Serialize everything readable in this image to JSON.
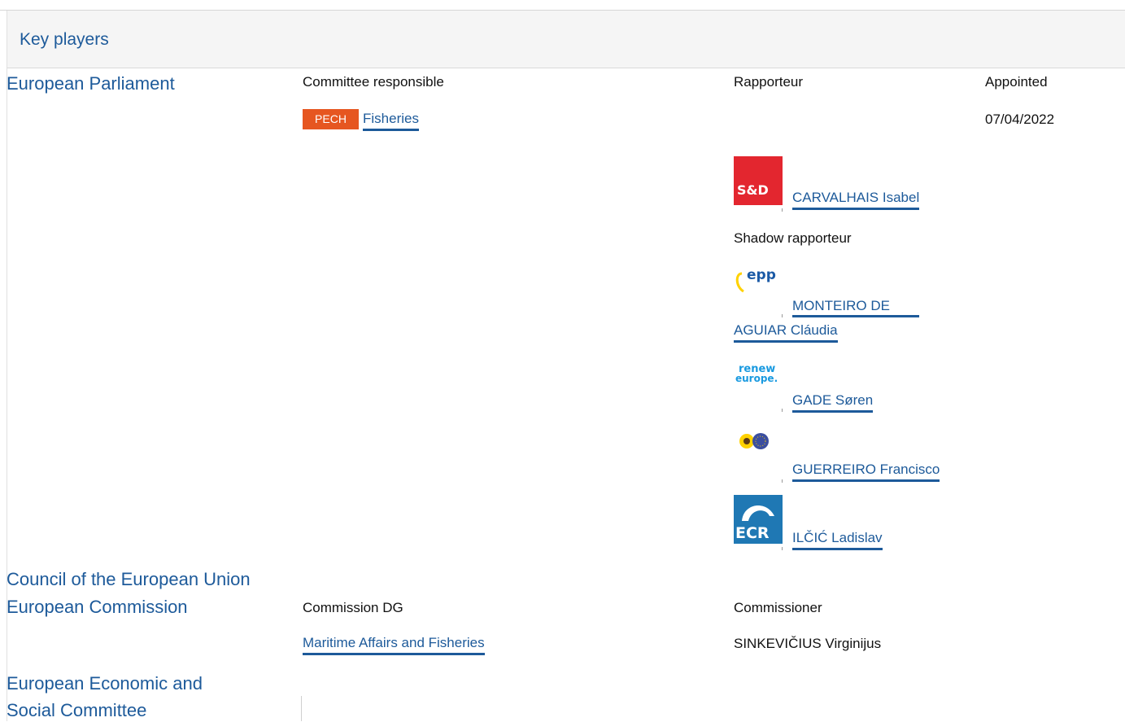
{
  "section": {
    "title": "Key players"
  },
  "parliament": {
    "name": "European Parliament",
    "committee_header": "Committee responsible",
    "rapporteur_header": "Rapporteur",
    "appointed_header": "Appointed",
    "committee_code": "PECH",
    "committee_name": "Fisheries",
    "appointed_date": "07/04/2022",
    "rapporteur": {
      "name": "CARVALHAIS Isabel",
      "group_logo": "S&D"
    },
    "shadow_header": "Shadow rapporteur",
    "shadows": [
      {
        "name_line1": "MONTEIRO DE",
        "name_line2": "AGUIAR Cláudia",
        "group_logo": "epp"
      },
      {
        "name": "GADE Søren",
        "group_logo_line1": "renew",
        "group_logo_line2": "europe."
      },
      {
        "name": "GUERREIRO Francisco",
        "group_logo": "greens-efa-icon"
      },
      {
        "name": "ILČIĆ Ladislav",
        "group_logo": "ECR"
      }
    ]
  },
  "council": {
    "name": "Council of the European Union"
  },
  "commission": {
    "name": "European Commission",
    "dg_header": "Commission DG",
    "commissioner_header": "Commissioner",
    "dg_name": "Maritime Affairs and Fisheries",
    "commissioner_name": "SINKEVIČIUS Virginijus"
  },
  "eesc": {
    "name_line1": "European Economic and",
    "name_line2": "Social Committee"
  },
  "colors": {
    "link": "#1d5a9a",
    "badge": "#e65620",
    "sd_red": "#e3262f",
    "ecr_blue": "#1f78b4"
  }
}
